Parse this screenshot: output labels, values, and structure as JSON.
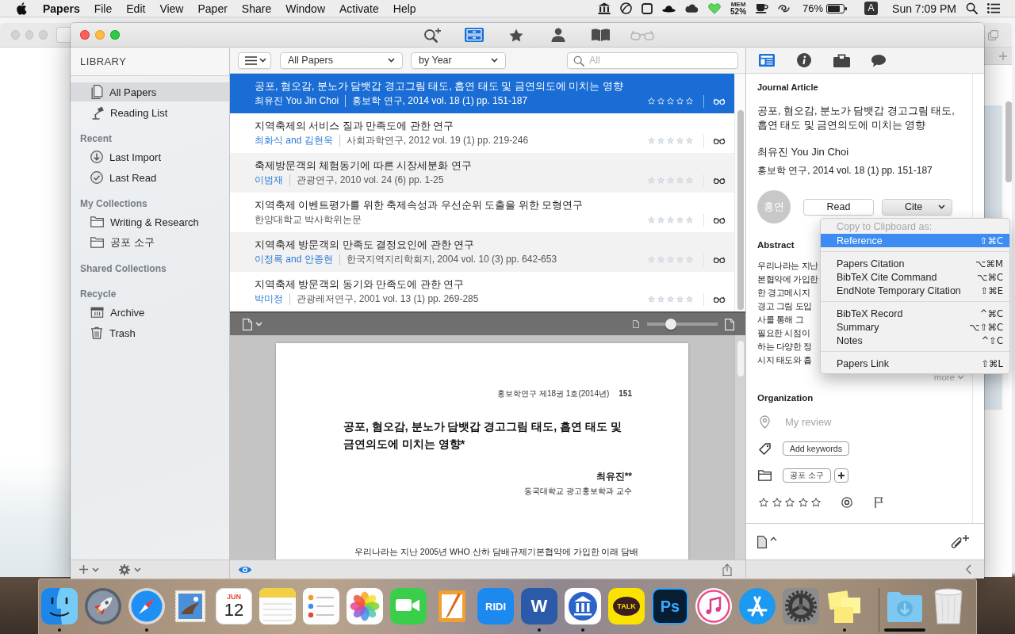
{
  "menu_bar": {
    "app_name": "Papers",
    "menus": [
      "File",
      "Edit",
      "View",
      "Paper",
      "Share",
      "Window",
      "Activate",
      "Help"
    ],
    "memory": {
      "label": "MEM",
      "value": "52%"
    },
    "battery": "76%",
    "input_source": "A",
    "clock": "Sun 7:09 PM"
  },
  "toolbar": [
    {
      "kind": "search_add",
      "selected": false,
      "disabled": false
    },
    {
      "kind": "library",
      "selected": true,
      "disabled": false
    },
    {
      "kind": "favorites",
      "selected": false,
      "disabled": false
    },
    {
      "kind": "people",
      "selected": false,
      "disabled": false
    },
    {
      "kind": "reader",
      "selected": false,
      "disabled": false
    },
    {
      "kind": "glasses",
      "selected": false,
      "disabled": true
    }
  ],
  "sidebar": {
    "title": "LIBRARY",
    "sections": [
      {
        "items": [
          {
            "kind": "papers",
            "label": "All Papers",
            "selected": true
          },
          {
            "kind": "lamp",
            "label": "Reading List",
            "selected": false
          }
        ]
      },
      {
        "title": "Recent",
        "items": [
          {
            "kind": "import",
            "label": "Last Import",
            "selected": false
          },
          {
            "kind": "read",
            "label": "Last Read",
            "selected": false
          }
        ]
      },
      {
        "title": "My Collections",
        "items": [
          {
            "kind": "folder",
            "label": "Writing & Research",
            "selected": false
          },
          {
            "kind": "folder",
            "label": "공포 소구",
            "selected": false
          }
        ]
      },
      {
        "title": "Shared Collections"
      },
      {
        "title": "Recycle",
        "items": [
          {
            "kind": "archive",
            "label": "Archive",
            "selected": false
          },
          {
            "kind": "trash",
            "label": "Trash",
            "selected": false
          }
        ]
      }
    ]
  },
  "papers": {
    "filters": [
      "All Papers",
      "by Year"
    ],
    "search": {
      "placeholder": "All"
    },
    "rows": [
      {
        "title": "공포, 혐오감, 분노가 담뱃갑 경고그림 태도, 흡연 태도 및 금연의도에 미치는 영향",
        "authors": "최유진 You Jin Choi",
        "source": "홍보학 연구, 2014 vol. 18 (1) pp. 151-187",
        "selected": true,
        "stars": 0
      },
      {
        "title": "지역축제의 서비스 질과 만족도에 관한 연구",
        "authors": "최화식 and 김현욱",
        "source": "사회과학연구, 2012 vol. 19 (1) pp. 219-246",
        "selected": false,
        "stars": 0
      },
      {
        "title": "축제방문객의 체험동기에 따른 시장세분화 연구",
        "authors": "이범재",
        "source": "관광연구, 2010 vol. 24 (6) pp. 1-25",
        "selected": false,
        "stars": 0
      },
      {
        "title": "지역축제 이벤트평가를 위한 축제속성과 우선순위 도출을 위한 모형연구",
        "source": "한양대학교 박사학위논문",
        "selected": false,
        "stars": 0
      },
      {
        "title": "지역축제 방문객의 만족도 결정요인에 관한 연구",
        "authors": "이정록 and 안종현",
        "source": "한국지역지리학회지, 2004 vol. 10 (3) pp. 642-653",
        "selected": false,
        "stars": 0
      },
      {
        "title": "지역축제 방문객의 동기와 만족도에 관한 연구",
        "authors": "박미정",
        "source": "관광레저연구, 2001 vol. 13 (1) pp. 269-285",
        "selected": false,
        "stars": 0
      }
    ]
  },
  "pdf_viewer": {
    "zoom": {
      "level": 0.3
    },
    "page": {
      "running_head": "홍보학연구 제18권 1호(2014년)",
      "page_number": "151",
      "title": "공포, 혐오감, 분노가 담뱃갑 경고그림 태도, 흡연 태도 및 금연의도에 미치는 영향*",
      "author": "최유진**",
      "affiliation": "동국대학교 광고홍보학과 교수",
      "body": "우리나라는 지난 2005년 WHO 산하 담배규제기본협약에 가입한 이래 담배"
    }
  },
  "details": {
    "tabs": [
      {
        "kind": "article",
        "selected": true
      },
      {
        "kind": "info",
        "selected": false
      },
      {
        "kind": "briefcase",
        "selected": false
      },
      {
        "kind": "comments",
        "selected": false
      }
    ],
    "type": "Journal Article",
    "title": "공포, 혐오감, 분노가 담뱃갑 경고그림 태도, 흡연 태도 및 금연의도에 미치는 영향",
    "authors": "최유진 You Jin Choi",
    "source": "홍보학 연구, 2014 vol. 18 (1) pp. 151-187",
    "journal_badge": "홍연",
    "buttons": [
      {
        "kind": "plain",
        "label": "Read",
        "pressed": false
      },
      {
        "kind": "menu",
        "label": "Cite",
        "pressed": true
      }
    ],
    "abstract": {
      "heading": "Abstract",
      "lines": [
        "우리나라는 지난",
        "본협약에 가입한",
        "한 경고메시지",
        "경고 그림 도입",
        "사를 통해 그",
        "필요한 시점이",
        "하는 다양한 정",
        "시지 태도와 흡"
      ],
      "more": "more"
    },
    "organization": {
      "heading": "Organization",
      "review": {
        "placeholder": "My review"
      },
      "keywords_button": "Add keywords",
      "collections": [
        "공포 소구"
      ],
      "stars": 0
    }
  },
  "cite_menu": {
    "header": "Copy to Clipboard as:",
    "groups": [
      {
        "items": [
          {
            "label": "Reference",
            "shortcut": "⇧⌘C",
            "selected": true
          }
        ]
      },
      {
        "items": [
          {
            "label": "Papers Citation",
            "shortcut": "⌥⌘M",
            "selected": false
          },
          {
            "label": "BibTeX Cite Command",
            "shortcut": "⌥⌘C",
            "selected": false
          },
          {
            "label": "EndNote Temporary Citation",
            "shortcut": "⇧⌘E",
            "selected": false
          }
        ]
      },
      {
        "items": [
          {
            "label": "BibTeX Record",
            "shortcut": "^⌘C",
            "selected": false
          },
          {
            "label": "Summary",
            "shortcut": "⌥⇧⌘C",
            "selected": false
          },
          {
            "label": "Notes",
            "shortcut": "^⇧C",
            "selected": false
          }
        ]
      },
      {
        "items": [
          {
            "label": "Papers Link",
            "shortcut": "⇧⌘L",
            "selected": false
          }
        ]
      }
    ]
  },
  "dock": {
    "apps": [
      {
        "kind": "finder",
        "running": true
      },
      {
        "kind": "launchpad",
        "running": false
      },
      {
        "kind": "safari",
        "running": true
      },
      {
        "kind": "stamp",
        "running": false
      },
      {
        "kind": "calendar",
        "running": false,
        "month": "JUN",
        "day": "12"
      },
      {
        "kind": "notes",
        "running": false
      },
      {
        "kind": "reminders",
        "running": false
      },
      {
        "kind": "photos",
        "running": false
      },
      {
        "kind": "facetime",
        "running": false
      },
      {
        "kind": "pages",
        "running": false
      },
      {
        "kind": "ridi",
        "running": false,
        "text": "RIDI"
      },
      {
        "kind": "word",
        "running": true,
        "text": "W"
      },
      {
        "kind": "library",
        "running": true
      },
      {
        "kind": "kakaotalk",
        "running": false,
        "text": "TALK"
      },
      {
        "kind": "photoshop",
        "running": false,
        "text": "Ps"
      },
      {
        "kind": "music",
        "running": false
      },
      {
        "kind": "app_store",
        "running": false
      },
      {
        "kind": "system_preferences",
        "running": false
      },
      {
        "kind": "stickies",
        "running": true
      }
    ],
    "stacks": [
      {
        "kind": "downloads"
      },
      {
        "kind": "trash"
      }
    ]
  }
}
